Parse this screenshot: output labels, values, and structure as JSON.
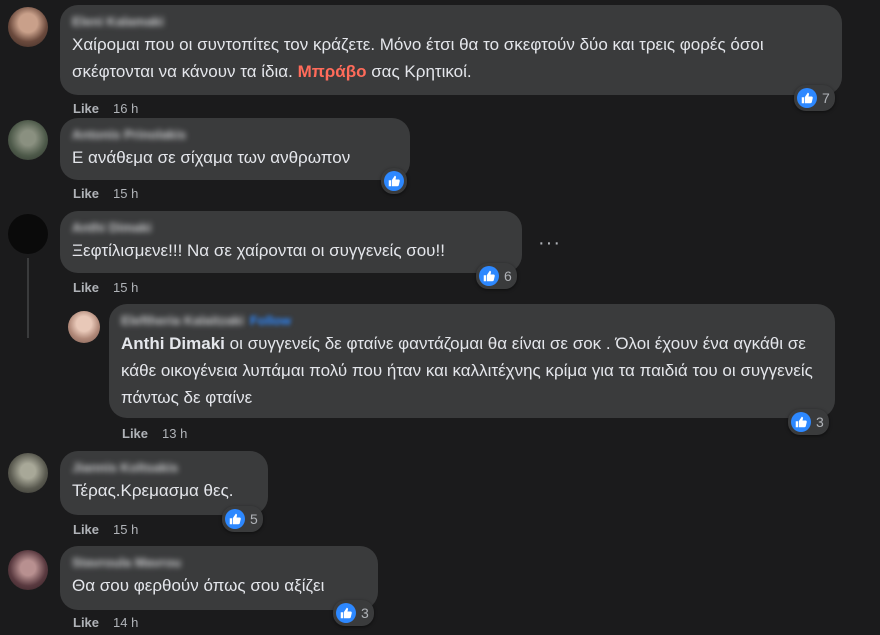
{
  "comments": [
    {
      "author": "Eleni Kalamaki",
      "text_parts": [
        "Χαίρομαι που οι συντοπίτες τον κράζετε. Μόνο έτσι θα το σκεφτούν δύο και τρεις φορές όσοι σκέφτονται να κάνουν τα ίδια. ",
        "Μπράβο",
        " σας Κρητικοί."
      ],
      "like_label": "Like",
      "time": "16 h",
      "reactions": "7"
    },
    {
      "author": "Antonis Prinolakis",
      "text": "Ε ανάθεμα σε σίχαμα των ανθρωπον",
      "like_label": "Like",
      "time": "15 h",
      "reactions": ""
    },
    {
      "author": "Anthi Dimaki",
      "text": "Ξεφτίλισμενε!!! Να σε χαίρονται οι συγγενείς σου!!",
      "like_label": "Like",
      "time": "15 h",
      "reactions": "6",
      "more_label": "···",
      "reply": {
        "author": "Eleftheria Kalaitzaki",
        "follow_label": "Follow",
        "mention": "Anthi Dimaki",
        "text": " οι συγγενείς δε φταίνε φαντάζομαι θα είναι σε σοκ . Όλοι έχουν ένα αγκάθι σε κάθε οικογένεια λυπάμαι πολύ που ήταν και καλλιτέχνης κρίμα για τα παιδιά του οι συγγενείς πάντως δε φταίνε",
        "like_label": "Like",
        "time": "13 h",
        "reactions": "3"
      }
    },
    {
      "author": "Jiannis Koltsakis",
      "text": "Τέρας.Κρεμασμα θες.",
      "like_label": "Like",
      "time": "15 h",
      "reactions": "5"
    },
    {
      "author": "Stavroula Mavrou",
      "text": "Θα σου φερθούν όπως σου αξίζει",
      "like_label": "Like",
      "time": "14 h",
      "reactions": "3"
    }
  ],
  "colors": {
    "background": "#1b1b1c",
    "bubble": "#3a3b3c",
    "like_blue": "#2d88ff",
    "highlight": "#ff6b5a"
  },
  "icons": {
    "like": "thumbs-up-icon",
    "more": "more-options-icon"
  }
}
